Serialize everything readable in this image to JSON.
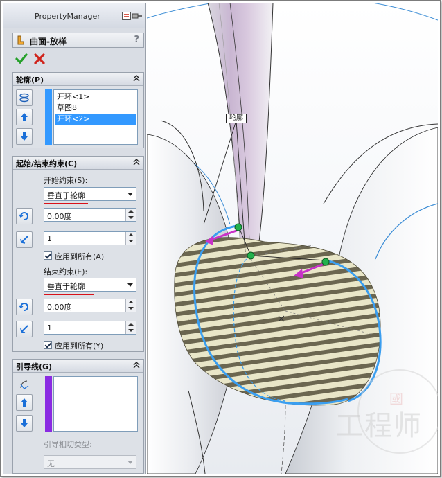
{
  "property_manager": {
    "title": "PropertyManager",
    "feature": {
      "title": "曲面-放样",
      "help": "?"
    },
    "actions": {
      "ok_icon": "check-icon",
      "cancel_icon": "x-icon"
    }
  },
  "profile_group": {
    "title": "轮廓(P)",
    "items": [
      {
        "label": "开环<1>",
        "selected": false
      },
      {
        "label": "草图8",
        "selected": false
      },
      {
        "label": "开环<2>",
        "selected": true
      }
    ]
  },
  "constraints_group": {
    "title": "起始/结束约束(C)",
    "start_label": "开始约束(S):",
    "start_value": "垂直于轮廓",
    "start_angle": "0.00度",
    "start_length": "1",
    "start_apply_all": "应用到所有(A)",
    "end_label": "结束约束(E):",
    "end_value": "垂直于轮廓",
    "end_angle": "0.00度",
    "end_length": "1",
    "end_apply_all": "应用到所有(Y)"
  },
  "guide_group": {
    "title": "引导线(G)",
    "tangency_label": "引导相切类型:",
    "tangency_value": "无"
  },
  "viewport": {
    "callout": "轮廓",
    "watermark": "工程师",
    "seal": "國"
  },
  "colors": {
    "selection": "#3399ff",
    "profile_strip": "#3399ff",
    "guide_strip": "#8a2be2",
    "underline": "#d8121b",
    "zebra_dark": "#6b6650",
    "zebra_light": "#e9e6c8",
    "profile_curve": "#3a9ef0",
    "arrow": "#c832c8",
    "point": "#22b14c"
  }
}
